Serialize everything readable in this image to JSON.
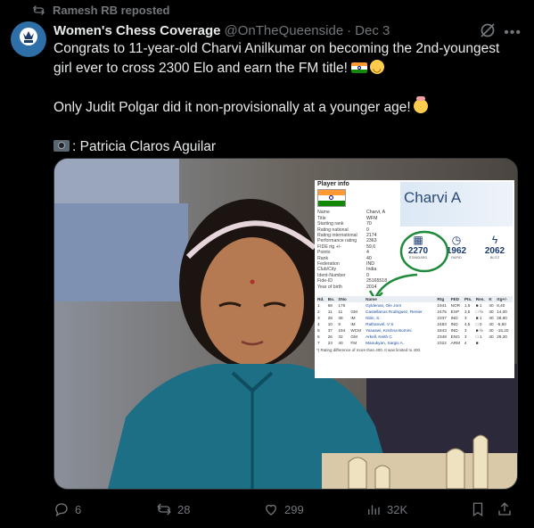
{
  "repost": {
    "label": "Ramesh RB reposted"
  },
  "author": {
    "name": "Women's Chess Coverage",
    "handle": "@OnTheQueenside",
    "separator": "·",
    "date": "Dec 3"
  },
  "tweet": {
    "line1": "Congrats to 11-year-old Charvi Anilkumar on becoming the 2nd-youngest girl ever to cross 2300 Elo and earn the FM title!",
    "line2": "Only Judit Polgar did it non-provisionally at a younger age!",
    "line3": ": Patricia Claros Aguilar"
  },
  "card": {
    "title": "Player info",
    "player_name": "Charvi A",
    "info": [
      {
        "k": "Name",
        "v": "Charvi, A"
      },
      {
        "k": "Title",
        "v": "WFM"
      },
      {
        "k": "Starting rank",
        "v": "70"
      },
      {
        "k": "Rating national",
        "v": "0"
      },
      {
        "k": "Rating international",
        "v": "2174"
      },
      {
        "k": "Performance rating",
        "v": "2363"
      },
      {
        "k": "FIDE rtg +/-",
        "v": "59,6"
      },
      {
        "k": "Points",
        "v": "4"
      },
      {
        "k": "Rank",
        "v": "40"
      },
      {
        "k": "Federation",
        "v": "IND"
      },
      {
        "k": "Club/City",
        "v": "India"
      },
      {
        "k": "Ident-Number",
        "v": "0"
      },
      {
        "k": "Fide-ID",
        "v": "25165518"
      },
      {
        "k": "Year of birth",
        "v": "2014"
      }
    ],
    "ratings": [
      {
        "value": "2270",
        "label": "STANDARD",
        "icon": "▦"
      },
      {
        "value": "1962",
        "label": "RAPID",
        "icon": "◷"
      },
      {
        "value": "2062",
        "label": "BLITZ",
        "icon": "ϟ"
      }
    ],
    "game_headers": [
      "Rd.",
      "Bo.",
      "SNo",
      "",
      "Name",
      "Rtg",
      "FED",
      "Pts.",
      "Res.",
      "K",
      "rtg+/-"
    ],
    "games": [
      [
        "1",
        "68",
        "176",
        "",
        "Gyldenas, Ole Jorn",
        "1941",
        "NOR",
        "1,5",
        "■ 1",
        "40",
        "8,40"
      ],
      [
        "2",
        "11",
        "11",
        "GM",
        "Castellanos Rodriguez, Renier",
        "2475",
        "ESP",
        "3,5",
        "□ ½",
        "40",
        "14,00"
      ],
      [
        "3",
        "28",
        "38",
        "IM",
        "Nitin, S.",
        "2337",
        "IND",
        "3",
        "■ 1",
        "40",
        "28,80"
      ],
      [
        "4",
        "10",
        "9",
        "IM",
        "Rathanvel, V S",
        "2483",
        "IND",
        "4,5",
        "□ 0",
        "40",
        "-5,60"
      ],
      [
        "5",
        "37",
        "194",
        "WCM",
        "Yasaswi, Krishna Bommi",
        "1843",
        "IND",
        "3",
        "■ ½",
        "40",
        "-15,20"
      ],
      [
        "6",
        "26",
        "32",
        "GM",
        "Arkell, Keith C",
        "2348",
        "ENG",
        "3",
        "□ 1",
        "40",
        "29,20"
      ],
      [
        "7",
        "23",
        "40",
        "FM",
        "Manukyan, Sargis A.",
        "2322",
        "ARM",
        "4",
        "■",
        "",
        ""
      ]
    ],
    "footnote": "*) Rating difference of more than 400. It was limited to 400."
  },
  "actions": {
    "replies": "6",
    "reposts": "28",
    "likes": "299",
    "views": "32K"
  },
  "colors": {
    "accent": "#1d9bf0",
    "muted": "#71767b",
    "bg": "#000000",
    "circle": "#1f8a3a"
  },
  "icons": [
    "repost-icon",
    "grok-icon",
    "more-icon",
    "reply-icon",
    "like-icon",
    "views-icon",
    "bookmark-icon",
    "share-icon"
  ]
}
